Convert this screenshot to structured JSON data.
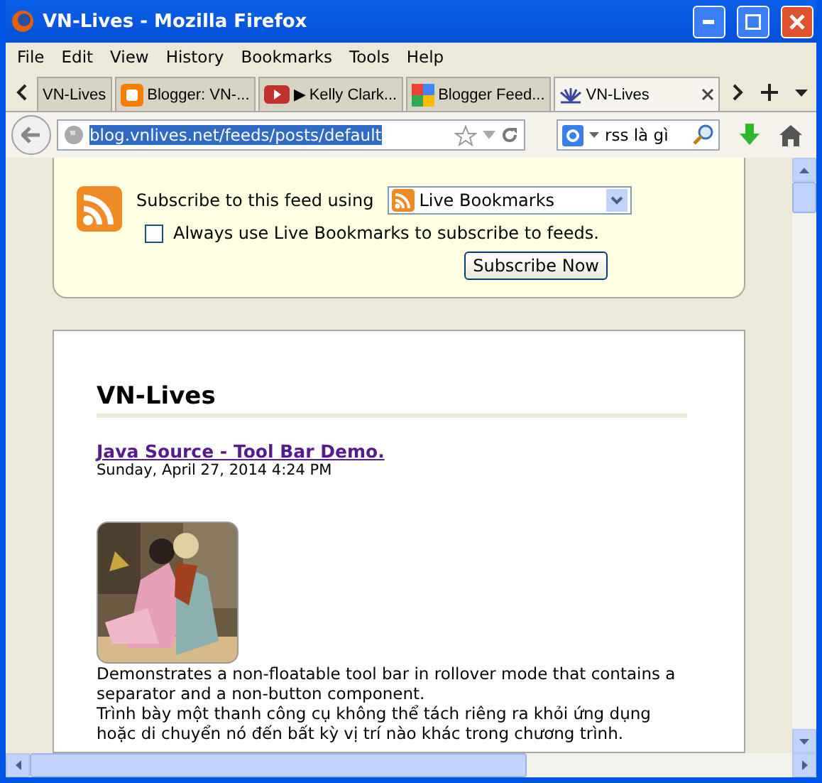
{
  "window": {
    "title": "VN-Lives - Mozilla Firefox"
  },
  "menu": [
    "File",
    "Edit",
    "View",
    "History",
    "Bookmarks",
    "Tools",
    "Help"
  ],
  "tabs": [
    {
      "label": "VN-Lives",
      "kind": "plain",
      "selected": false
    },
    {
      "label": "Blogger: VN-...",
      "kind": "blogger",
      "selected": false
    },
    {
      "label": "▶ Kelly Clark...",
      "kind": "youtube",
      "selected": false
    },
    {
      "label": "Blogger Feed...",
      "kind": "google",
      "selected": false
    },
    {
      "label": "VN-Lives",
      "kind": "site",
      "selected": true
    }
  ],
  "address": {
    "value": "blog.vnlives.net/feeds/posts/default"
  },
  "search": {
    "value": "rss là gì"
  },
  "feed": {
    "label": "Subscribe to this feed using",
    "reader": "Live Bookmarks",
    "always_label": "Always use Live Bookmarks to subscribe to feeds.",
    "always_checked": false,
    "button": "Subscribe Now"
  },
  "blog": {
    "title": "VN-Lives",
    "post_title": "Java Source - Tool Bar Demo.",
    "date": "Sunday, April 27, 2014 4:24 PM",
    "lines": [
      "Demonstrates a non-floatable tool bar in rollover mode that contains a separator and a non-button component.",
      "Trình bày một thanh công cụ không thể tách riêng ra khỏi ứng dụng hoặc di chuyển nó đến bất kỳ vị trí nào khác trong chương trình."
    ]
  }
}
